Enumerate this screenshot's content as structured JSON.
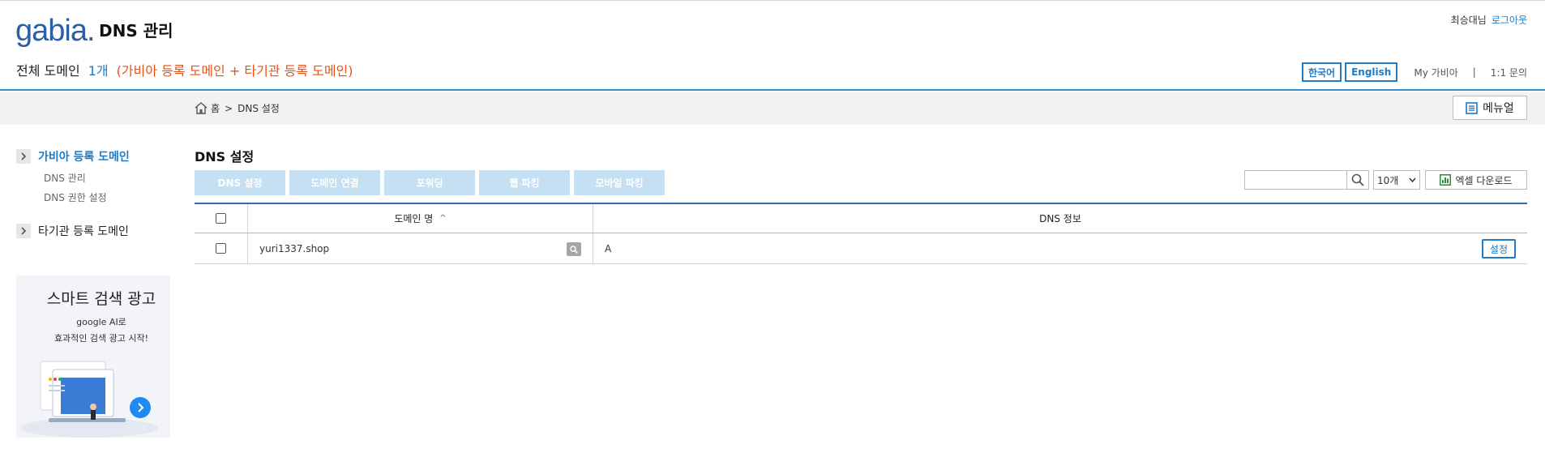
{
  "header": {
    "logo_text": "gabia",
    "logo_dot": ".",
    "app_title": "DNS 관리",
    "summary_label": "전체 도메인",
    "summary_count": "1개",
    "summary_detail": "(가비아 등록 도메인 + 타기관 등록 도메인)",
    "user_name": "최승대님",
    "logout": "로그아웃",
    "lang_ko": "한국어",
    "lang_en": "English",
    "my_gabia": "My 가비아",
    "separator": "|",
    "inquiry": "1:1 문의"
  },
  "breadcrumb": {
    "home": "홈",
    "arrow": ">",
    "current": "DNS 설정",
    "manual": "메뉴얼"
  },
  "sidebar": {
    "group1": "가비아 등록 도메인",
    "items": [
      "DNS 관리",
      "DNS 권한 설정"
    ],
    "group2": "타기관 등록 도메인"
  },
  "ad": {
    "title": "스마트 검색 광고",
    "line1": "google AI로",
    "line2": "효과적인 검색 광고 시작!"
  },
  "main": {
    "title": "DNS 설정",
    "tabs": [
      "DNS 설정",
      "도메인 연결",
      "포워딩",
      "웹 파킹",
      "모바일 파킹"
    ],
    "page_size": "10개",
    "excel": "엑셀 다운로드"
  },
  "table": {
    "col_domain": "도메인 명",
    "sort_indicator": "^",
    "col_dns": "DNS 정보",
    "rows": [
      {
        "domain": "yuri1337.shop",
        "dns": "A",
        "action": "설정"
      }
    ]
  },
  "colors": {
    "accent": "#1f7ac4",
    "highlight": "#e2541b",
    "tab_bg": "#c5dff3"
  }
}
